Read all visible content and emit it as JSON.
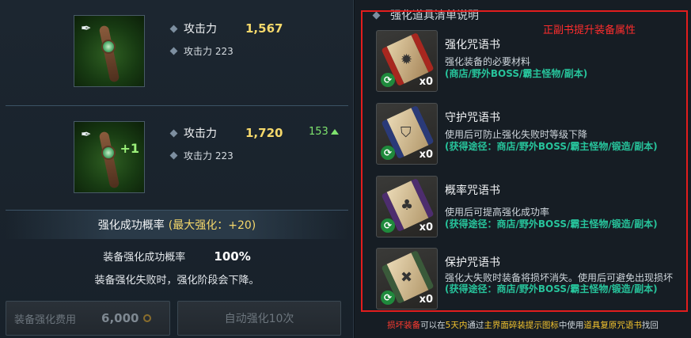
{
  "colors": {
    "accent_gold": "#f5d86b",
    "gain_green": "#7ee36e",
    "source_teal": "#27c39b",
    "warning_red": "#ff2d2d"
  },
  "left": {
    "item_current": {
      "icon": "staff-weapon-icon",
      "stat_main_label": "攻击力",
      "stat_main_value": "1,567",
      "stat_sub_label": "攻击力 223"
    },
    "item_next": {
      "icon": "staff-weapon-plus-icon",
      "plus_badge": "+1",
      "stat_main_label": "攻击力",
      "stat_main_value": "1,720",
      "gain_value": "153",
      "stat_sub_label": "攻击力 223"
    },
    "rate_title": "强化成功概率",
    "rate_max": "(最大强化：+20)",
    "success_label": "装备强化成功概率",
    "success_value": "100%",
    "fail_note": "装备强化失败时，强化阶段会下降。",
    "cost_label": "装备强化费用",
    "cost_value": "6,000",
    "auto_button": "自动强化10次"
  },
  "right": {
    "title": "强化道具清单说明",
    "annotation": "正副书提升装备属性",
    "scrolls": [
      {
        "name": "强化咒语书",
        "desc": "强化装备的必要材料",
        "source": "(商店/野外BOSS/霸主怪物/副本)",
        "qty": "x0"
      },
      {
        "name": "守护咒语书",
        "desc": "使用后可防止强化失败时等级下降",
        "source": "(获得途径：商店/野外BOSS/霸主怪物/锻造/副本)",
        "qty": "x0"
      },
      {
        "name": "概率咒语书",
        "desc": "使用后可提高强化成功率",
        "source": "(获得途径：商店/野外BOSS/霸主怪物/锻造/副本)",
        "qty": "x0"
      },
      {
        "name": "保护咒语书",
        "desc": "强化大失败时装备将损坏消失。使用后可避免出现损坏",
        "source": "(获得途径：商店/野外BOSS/霸主怪物/锻造/副本)",
        "qty": "x0"
      }
    ],
    "footer": {
      "p1": "损坏装备",
      "p2": "可以在",
      "p3": "5天内",
      "p4": "通过",
      "p5": "主界面碎装提示图标",
      "p6": "中使用",
      "p7": "道具复原咒语书",
      "p8": "找回"
    }
  }
}
